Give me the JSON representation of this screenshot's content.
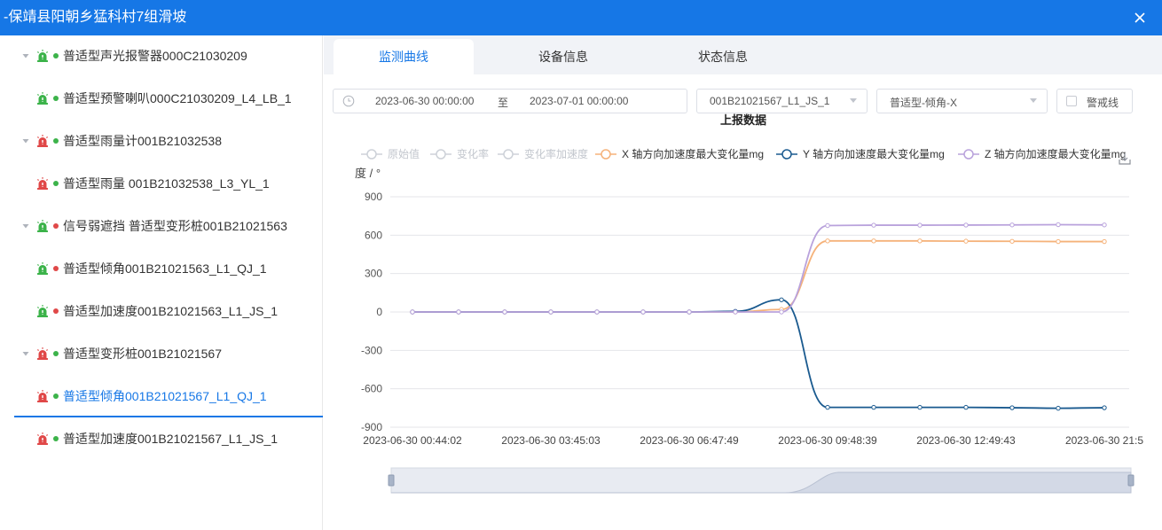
{
  "window": {
    "title": "-保靖县阳朝乡猛科村7组滑坡"
  },
  "sidebar": {
    "nodes": [
      {
        "label": "普适型声光报警器000C21030209",
        "level": 0,
        "status": "#3cb34a",
        "alarm": "#3cb34a"
      },
      {
        "label": "普适型预警喇叭000C21030209_L4_LB_1",
        "level": 1,
        "status": "#3cb34a",
        "alarm": "#3cb34a"
      },
      {
        "label": "普适型雨量计001B21032538",
        "level": 0,
        "status": "#3cb34a",
        "alarm": "#e04848"
      },
      {
        "label": "普适型雨量 001B21032538_L3_YL_1",
        "level": 1,
        "status": "#3cb34a",
        "alarm": "#e04848"
      },
      {
        "label": "信号弱遮挡 普适型变形桩001B21021563",
        "level": 0,
        "status": "#e04848",
        "alarm": "#3cb34a"
      },
      {
        "label": "普适型倾角001B21021563_L1_QJ_1",
        "level": 1,
        "status": "#e04848",
        "alarm": "#3cb34a"
      },
      {
        "label": "普适型加速度001B21021563_L1_JS_1",
        "level": 1,
        "status": "#e04848",
        "alarm": "#3cb34a"
      },
      {
        "label": "普适型变形桩001B21021567",
        "level": 0,
        "status": "#3cb34a",
        "alarm": "#e04848"
      },
      {
        "label": "普适型倾角001B21021567_L1_QJ_1",
        "level": 1,
        "status": "#3cb34a",
        "alarm": "#e04848",
        "selected": true
      },
      {
        "label": "普适型加速度001B21021567_L1_JS_1",
        "level": 1,
        "status": "#3cb34a",
        "alarm": "#e04848"
      }
    ]
  },
  "tabs": [
    {
      "label": "监测曲线",
      "active": true
    },
    {
      "label": "设备信息",
      "active": false
    },
    {
      "label": "状态信息",
      "active": false
    }
  ],
  "filters": {
    "start": "2023-06-30 00:00:00",
    "separator": "至",
    "end": "2023-07-01 00:00:00",
    "device": "001B21021567_L1_JS_1",
    "metric": "普适型-倾角-X",
    "warning_line": "警戒线"
  },
  "colors": {
    "accent": "#1677e6",
    "online": "#3cb34a",
    "offline": "#e04848"
  },
  "chart_data": {
    "type": "line",
    "title": "上报数据",
    "ylabel": "度 / °",
    "ylim": [
      -900,
      900
    ],
    "yticks": [
      900,
      600,
      300,
      0,
      -300,
      -600,
      -900
    ],
    "xtick_labels": [
      "2023-06-30 00:44:02",
      "2023-06-30 03:45:03",
      "2023-06-30 06:47:49",
      "2023-06-30 09:48:39",
      "2023-06-30 12:49:43",
      "2023-06-30 21:5"
    ],
    "point_index_ticks": [
      0,
      3,
      6,
      9,
      12,
      15
    ],
    "series": [
      {
        "name": "原始值",
        "color": "#c8ccd4",
        "enabled": false,
        "values": []
      },
      {
        "name": "变化率",
        "color": "#c8ccd4",
        "enabled": false,
        "values": []
      },
      {
        "name": "变化率加速度",
        "color": "#c8ccd4",
        "enabled": false,
        "values": []
      },
      {
        "name": "X 轴方向加速度最大变化量mg",
        "color": "#f5b27a",
        "enabled": true,
        "values": [
          0,
          0,
          0,
          0,
          0,
          0,
          0,
          0,
          20,
          555,
          555,
          555,
          553,
          552,
          550,
          550
        ]
      },
      {
        "name": "Y 轴方向加速度最大变化量mg",
        "color": "#1a5a8f",
        "enabled": true,
        "values": [
          0,
          0,
          0,
          0,
          0,
          0,
          0,
          5,
          95,
          -745,
          -745,
          -745,
          -745,
          -748,
          -752,
          -748
        ]
      },
      {
        "name": "Z 轴方向加速度最大变化量mg",
        "color": "#b9a2dc",
        "enabled": true,
        "values": [
          0,
          0,
          0,
          0,
          0,
          0,
          0,
          0,
          0,
          675,
          678,
          678,
          679,
          680,
          682,
          680
        ]
      }
    ],
    "legend_position": "top",
    "grid": true
  }
}
